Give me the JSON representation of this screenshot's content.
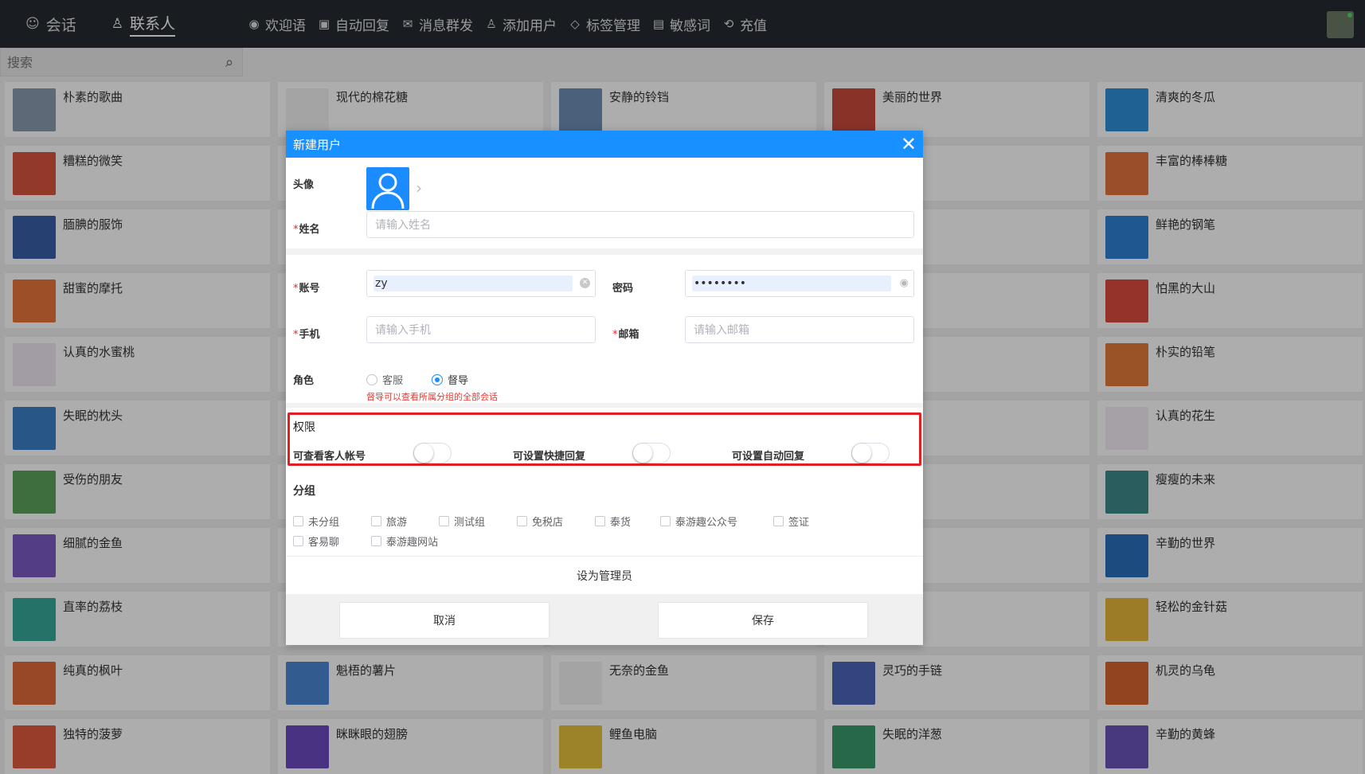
{
  "header": {
    "tabs": [
      {
        "label": "会话",
        "icon": "chat-icon"
      },
      {
        "label": "联系人",
        "icon": "contacts-icon"
      }
    ],
    "menu": [
      {
        "label": "欢迎语",
        "icon": "welcome-icon"
      },
      {
        "label": "自动回复",
        "icon": "robot-icon"
      },
      {
        "label": "消息群发",
        "icon": "mail-icon"
      },
      {
        "label": "添加用户",
        "icon": "add-user-icon"
      },
      {
        "label": "标签管理",
        "icon": "tag-icon"
      },
      {
        "label": "敏感词",
        "icon": "document-icon"
      },
      {
        "label": "充值",
        "icon": "recharge-icon"
      }
    ]
  },
  "search": {
    "placeholder": "搜索"
  },
  "contacts": [
    {
      "name": "朴素的歌曲",
      "color": "#8a9bb0"
    },
    {
      "name": "现代的棉花糖",
      "color": "#f2f2f2"
    },
    {
      "name": "安静的铃铛",
      "color": "#6e8fb5"
    },
    {
      "name": "美丽的世界",
      "color": "#c94a3c"
    },
    {
      "name": "清爽的冬瓜",
      "color": "#2f8fd8"
    },
    {
      "name": "糟糕的微笑",
      "color": "#d9553f"
    },
    {
      "name": "",
      "color": "#ffffff"
    },
    {
      "name": "",
      "color": "#ffffff"
    },
    {
      "name": "",
      "color": "#ffffff"
    },
    {
      "name": "丰富的棒棒糖",
      "color": "#e3753f"
    },
    {
      "name": "腼腆的服饰",
      "color": "#3a5fa8"
    },
    {
      "name": "",
      "color": "#ffffff"
    },
    {
      "name": "",
      "color": "#ffffff"
    },
    {
      "name": "",
      "color": "#ffffff"
    },
    {
      "name": "鲜艳的钢笔",
      "color": "#2f82d4"
    },
    {
      "name": "甜蜜的摩托",
      "color": "#e8763a"
    },
    {
      "name": "",
      "color": "#ffffff"
    },
    {
      "name": "",
      "color": "#ffffff"
    },
    {
      "name": "",
      "color": "#ffffff"
    },
    {
      "name": "怕黑的大山",
      "color": "#d94c3f"
    },
    {
      "name": "认真的水蜜桃",
      "color": "#efe8f4"
    },
    {
      "name": "",
      "color": "#ffffff"
    },
    {
      "name": "",
      "color": "#ffffff"
    },
    {
      "name": "",
      "color": "#ffffff"
    },
    {
      "name": "朴实的铅笔",
      "color": "#e47a3a"
    },
    {
      "name": "失眠的枕头",
      "color": "#3a7fc8"
    },
    {
      "name": "",
      "color": "#ffffff"
    },
    {
      "name": "",
      "color": "#ffffff"
    },
    {
      "name": "",
      "color": "#ffffff"
    },
    {
      "name": "认真的花生",
      "color": "#f3eef7"
    },
    {
      "name": "受伤的朋友",
      "color": "#5ea35c"
    },
    {
      "name": "",
      "color": "#ffffff"
    },
    {
      "name": "",
      "color": "#ffffff"
    },
    {
      "name": "",
      "color": "#ffffff"
    },
    {
      "name": "瘦瘦的未来",
      "color": "#3f8a8a"
    },
    {
      "name": "细腻的金鱼",
      "color": "#7b5cc2"
    },
    {
      "name": "",
      "color": "#ffffff"
    },
    {
      "name": "",
      "color": "#ffffff"
    },
    {
      "name": "",
      "color": "#ffffff"
    },
    {
      "name": "辛勤的世界",
      "color": "#2a6fbd"
    },
    {
      "name": "直率的荔枝",
      "color": "#35a89a"
    },
    {
      "name": "",
      "color": "#ffffff"
    },
    {
      "name": "",
      "color": "#ffffff"
    },
    {
      "name": "",
      "color": "#ffffff"
    },
    {
      "name": "轻松的金针菇",
      "color": "#e8b73a"
    },
    {
      "name": "纯真的枫叶",
      "color": "#e06b3a"
    },
    {
      "name": "魁梧的薯片",
      "color": "#4a86d4"
    },
    {
      "name": "无奈的金鱼",
      "color": "#f2f2f2"
    },
    {
      "name": "灵巧的手链",
      "color": "#4b67b8"
    },
    {
      "name": "机灵的乌龟",
      "color": "#d8652f"
    },
    {
      "name": "独特的菠萝",
      "color": "#e05a3f"
    },
    {
      "name": "眯眯眼的翅膀",
      "color": "#6a4bbf"
    },
    {
      "name": "鲤鱼电脑",
      "color": "#e8c23a"
    },
    {
      "name": "失眠的洋葱",
      "color": "#3a9a6a"
    },
    {
      "name": "辛勤的黄蜂",
      "color": "#6a55b8"
    }
  ],
  "modal": {
    "title": "新建用户",
    "avatar_label": "头像",
    "name_label": "姓名",
    "name_placeholder": "请输入姓名",
    "account_label": "账号",
    "account_value": "zy",
    "password_label": "密码",
    "password_value": "••••••••",
    "phone_label": "手机",
    "phone_placeholder": "请输入手机",
    "email_label": "邮箱",
    "email_placeholder": "请输入邮箱",
    "role_label": "角色",
    "roles": [
      {
        "label": "客服",
        "selected": false
      },
      {
        "label": "督导",
        "selected": true
      }
    ],
    "role_hint": "督导可以查看所属分组的全部会话",
    "permissions_label": "权限",
    "permissions": [
      {
        "label": "可查看客人帐号",
        "on": false
      },
      {
        "label": "可设置快捷回复",
        "on": false
      },
      {
        "label": "可设置自动回复",
        "on": false
      }
    ],
    "group_label": "分组",
    "groups": [
      "未分组",
      "旅游",
      "测试组",
      "免税店",
      "泰货",
      "泰游趣公众号",
      "签证",
      "客易聊",
      "泰游趣网站"
    ],
    "admin_label": "设为管理员",
    "cancel_label": "取消",
    "save_label": "保存",
    "required_mark": "*"
  }
}
